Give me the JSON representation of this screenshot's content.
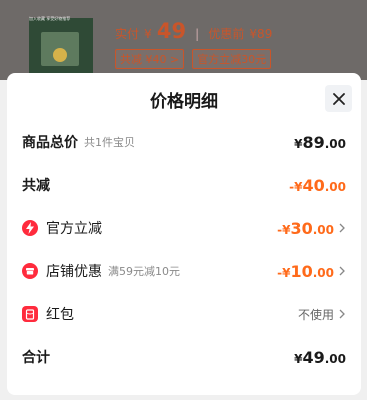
{
  "background": {
    "thumb_caption": "加入收藏 享受好物推荐",
    "price_label": "实付",
    "price_yen": "¥",
    "price_value": "49",
    "separator": "|",
    "original_label": "优惠前",
    "original_price": "¥89",
    "pill_total_discount": "共减 ¥40 >",
    "pill_official": "官方立减30元"
  },
  "sheet": {
    "title": "价格明细",
    "close_icon": "close-icon"
  },
  "rows": {
    "goods_total": {
      "label": "商品总价",
      "sub": "共1件宝贝",
      "yen": "¥",
      "int": "89",
      "dec": ".00"
    },
    "total_reduce": {
      "label": "共减",
      "yen": "-¥",
      "int": "40",
      "dec": ".00"
    },
    "official": {
      "label": "官方立减",
      "yen": "-¥",
      "int": "30",
      "dec": ".00",
      "icon": "lightning-icon"
    },
    "shop": {
      "label": "店铺优惠",
      "sub": "满59元减10元",
      "yen": "-¥",
      "int": "10",
      "dec": ".00",
      "icon": "shop-icon"
    },
    "red_packet": {
      "label": "红包",
      "value": "不使用",
      "icon": "red-packet-icon"
    },
    "sum": {
      "label": "合计",
      "yen": "¥",
      "int": "49",
      "dec": ".00"
    }
  },
  "colors": {
    "accent_orange": "#ff6a1a",
    "icon_red": "#ff2b3d",
    "text_dark": "#1a1a1a"
  }
}
